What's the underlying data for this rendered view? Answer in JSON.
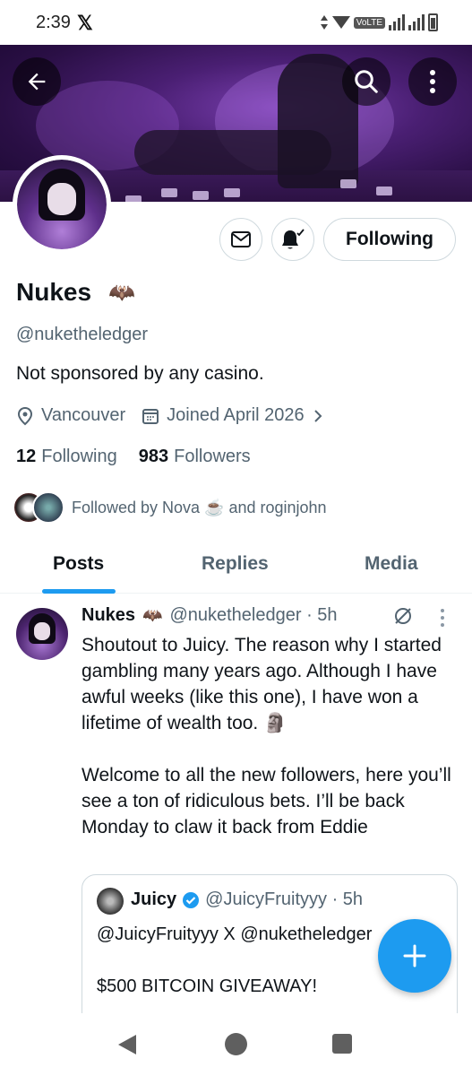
{
  "status_bar": {
    "time": "2:39",
    "app_icon": "x-logo",
    "network": "VoLTE",
    "icons": [
      "data-arrows-icon",
      "wifi-icon",
      "signal-icon",
      "battery-icon"
    ]
  },
  "header": {
    "back_icon": "arrow-left-icon",
    "search_icon": "search-icon",
    "more_icon": "more-vertical-icon"
  },
  "profile": {
    "display_name": "Nukes",
    "name_emoji": "🦇",
    "handle": "@nuketheledger",
    "bio": "Not sponsored by any casino.",
    "location": "Vancouver",
    "joined": "Joined April 2026",
    "following_count": "12",
    "following_label": "Following",
    "followers_count": "983",
    "followers_label": "Followers",
    "followed_by": "Followed by Nova ☕ and roginjohn"
  },
  "actions": {
    "follow_label": "Following",
    "message_icon": "mail-icon",
    "notify_icon": "bell-check-icon"
  },
  "tabs": [
    {
      "label": "Posts",
      "active": true
    },
    {
      "label": "Replies",
      "active": false
    },
    {
      "label": "Media",
      "active": false
    }
  ],
  "post": {
    "author_name": "Nukes",
    "author_emoji": "🦇",
    "author_handle": "@nuketheledger · 5h",
    "body": "Shoutout to Juicy. The reason why I started gambling many years ago. Although I have awful weeks (like this one), I have won a lifetime of wealth too. 🗿\n\nWelcome to all the new followers, here you’ll see a ton of ridiculous bets. I’ll be back Monday to claw it back from Eddie",
    "quote": {
      "author_name": "Juicy",
      "author_handle": "@JuicyFruityyy · 5h",
      "body": "@JuicyFruityyy X @nuketheledger\n\n$500 BITCOIN GIVEAWAY!"
    }
  },
  "colors": {
    "accent": "#1d9bf0",
    "secondary_text": "#536471",
    "border": "#cfd9de"
  }
}
